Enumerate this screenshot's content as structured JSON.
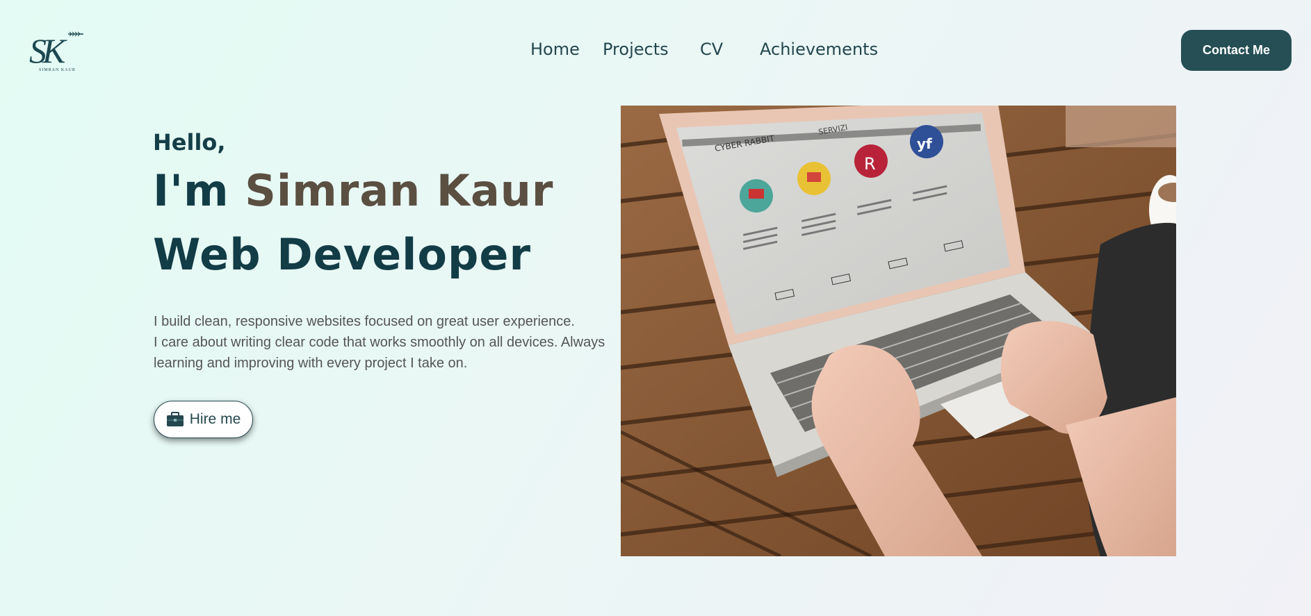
{
  "header": {
    "logo": {
      "icon": "sk-monogram-logo",
      "letters": "SK",
      "sub_text": "SIMRAN KAUR"
    },
    "nav": [
      {
        "label": "Home"
      },
      {
        "label": "Projects"
      },
      {
        "label": "CV"
      },
      {
        "label": "Achievements"
      }
    ],
    "contact_button": "Contact Me"
  },
  "hero": {
    "greeting": "Hello,",
    "name_prefix": "I'm ",
    "name": "Simran Kaur",
    "role": "Web Developer",
    "description": [
      "I build clean, responsive websites focused on great user experience.",
      "I care about writing clear code that works smoothly on all devices. Always learning and improving with every project I take on."
    ],
    "hire_button": {
      "icon": "briefcase-icon",
      "label": "Hire me"
    },
    "image": {
      "icon": "laptop-photo",
      "alt": "Hands typing on a MacBook Air on a wooden table"
    }
  },
  "colors": {
    "primary": "#254f55",
    "accent_name": "#5b4f42",
    "heading": "#123c46",
    "text": "#555555"
  }
}
